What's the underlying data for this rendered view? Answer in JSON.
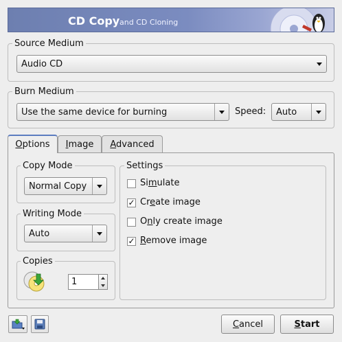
{
  "banner": {
    "title": "CD Copy",
    "subtitle": "and CD Cloning"
  },
  "source_medium": {
    "label": "Source Medium",
    "selected": "Audio CD"
  },
  "burn_medium": {
    "label": "Burn Medium",
    "selected": "Use the same device for burning",
    "speed_label": "Speed:",
    "speed_selected": "Auto"
  },
  "tabs": [
    {
      "label": "Options",
      "active": true
    },
    {
      "label": "Image",
      "active": false
    },
    {
      "label": "Advanced",
      "active": false
    }
  ],
  "copy_mode": {
    "label": "Copy Mode",
    "selected": "Normal Copy"
  },
  "writing_mode": {
    "label": "Writing Mode",
    "selected": "Auto"
  },
  "copies": {
    "label": "Copies",
    "value": "1"
  },
  "settings": {
    "label": "Settings",
    "options": [
      {
        "label": "Simulate",
        "checked": false
      },
      {
        "label": "Create image",
        "checked": true
      },
      {
        "label": "Only create image",
        "checked": false
      },
      {
        "label": "Remove image",
        "checked": true
      }
    ]
  },
  "buttons": {
    "cancel": "Cancel",
    "start": "Start"
  },
  "icons": {
    "load": "load-settings-icon",
    "save": "save-settings-icon",
    "copies": "cd-copies-icon"
  }
}
